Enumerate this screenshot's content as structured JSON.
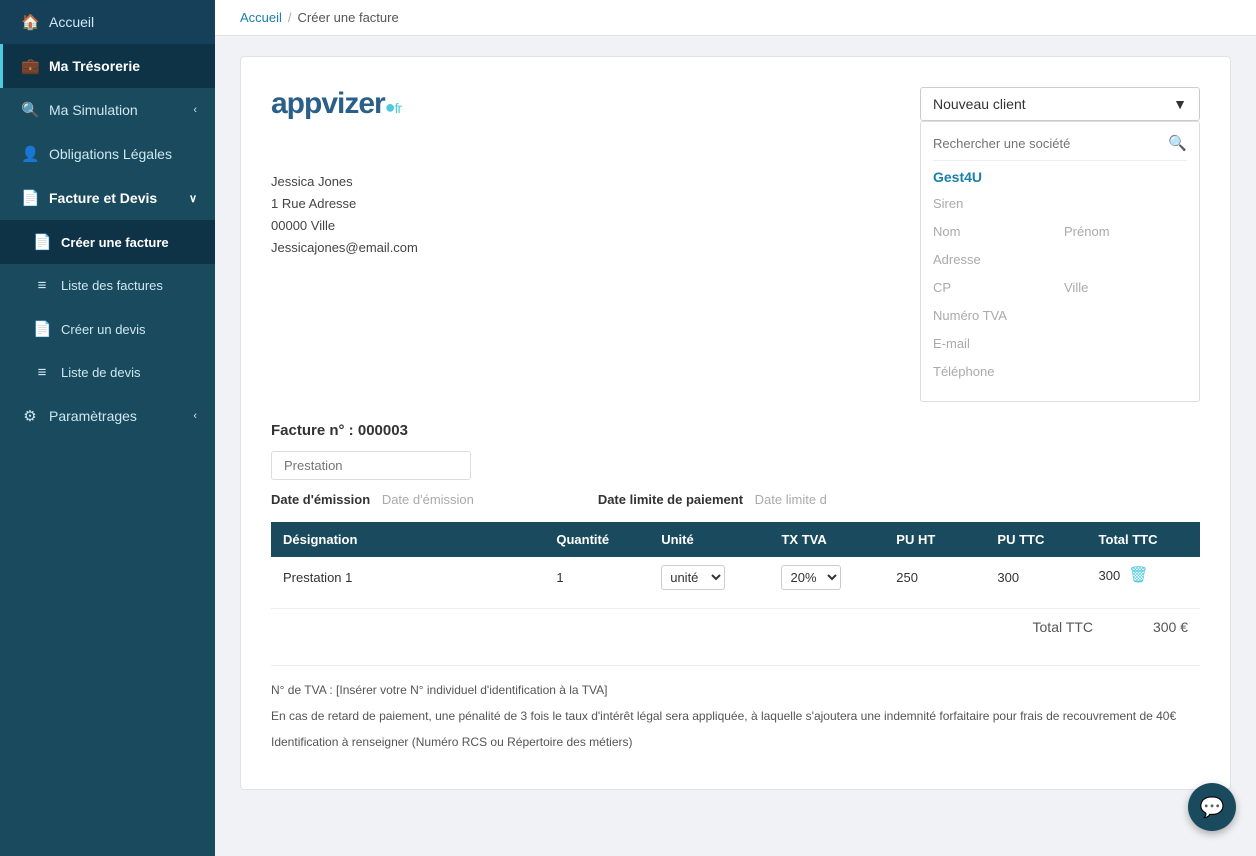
{
  "sidebar": {
    "items": [
      {
        "label": "Accueil",
        "icon": "🏠",
        "id": "accueil",
        "type": "top"
      },
      {
        "label": "Ma Trésorerie",
        "icon": "💼",
        "id": "tresorerie",
        "type": "top"
      },
      {
        "label": "Ma Simulation",
        "icon": "🔍",
        "id": "simulation",
        "type": "top",
        "chevron": "‹"
      },
      {
        "label": "Obligations Légales",
        "icon": "👤",
        "id": "obligations",
        "type": "top"
      },
      {
        "label": "Facture et Devis",
        "icon": "📄",
        "id": "factures",
        "type": "section",
        "chevron": "∨"
      },
      {
        "label": "Créer une facture",
        "icon": "📄",
        "id": "creer-facture",
        "type": "sub"
      },
      {
        "label": "Liste des factures",
        "icon": "≡",
        "id": "liste-factures",
        "type": "sub"
      },
      {
        "label": "Créer un devis",
        "icon": "📄",
        "id": "creer-devis",
        "type": "sub"
      },
      {
        "label": "Liste de devis",
        "icon": "≡",
        "id": "liste-devis",
        "type": "sub"
      },
      {
        "label": "Paramètrages",
        "icon": "⚙",
        "id": "parametrages",
        "type": "top",
        "chevron": "‹"
      }
    ]
  },
  "breadcrumb": {
    "home": "Accueil",
    "separator": "/",
    "current": "Créer une facture"
  },
  "logo": {
    "text_dark": "appvizer",
    "text_accent": "●",
    "tagline": "fr"
  },
  "sender": {
    "name": "Jessica Jones",
    "address": "1 Rue Adresse",
    "city": "00000 Ville",
    "email": "Jessicajones@email.com"
  },
  "client_section": {
    "dropdown_label": "Nouveau client",
    "dropdown_arrow": "▼",
    "search_placeholder": "Rechercher une société",
    "company_name": "Gest4U",
    "fields": {
      "siren": "Siren",
      "nom": "Nom",
      "prenom": "Prénom",
      "adresse": "Adresse",
      "cp": "CP",
      "ville": "Ville",
      "numero_tva": "Numéro TVA",
      "email": "E-mail",
      "telephone": "Téléphone"
    }
  },
  "invoice": {
    "number_label": "Facture n° :",
    "number_value": "000003",
    "prestation_placeholder": "Prestation",
    "date_emission_label": "Date d'émission",
    "date_emission_placeholder": "Date d'émission",
    "date_paiement_label": "Date limite de paiement",
    "date_paiement_placeholder": "Date limite d",
    "table": {
      "headers": [
        "Désignation",
        "Quantité",
        "Unité",
        "TX TVA",
        "PU HT",
        "PU TTC",
        "Total TTC"
      ],
      "rows": [
        {
          "designation": "Prestation 1",
          "quantite": "1",
          "unite": "unité",
          "tx_tva": "20%",
          "pu_ht": "250",
          "pu_ttc": "300",
          "total_ttc": "300"
        }
      ]
    },
    "total_label": "Total TTC",
    "total_value": "300 €"
  },
  "footer_notes": [
    "N° de TVA : [Insérer votre N° individuel d'identification à la TVA]",
    "En cas de retard de paiement, une pénalité de 3 fois le taux d'intérêt légal sera appliquée, à laquelle s'ajoutera une indemnité forfaitaire pour frais de recouvrement de 40€",
    "Identification à renseigner (Numéro RCS ou Répertoire des métiers)"
  ],
  "chat": {
    "icon": "💬"
  }
}
